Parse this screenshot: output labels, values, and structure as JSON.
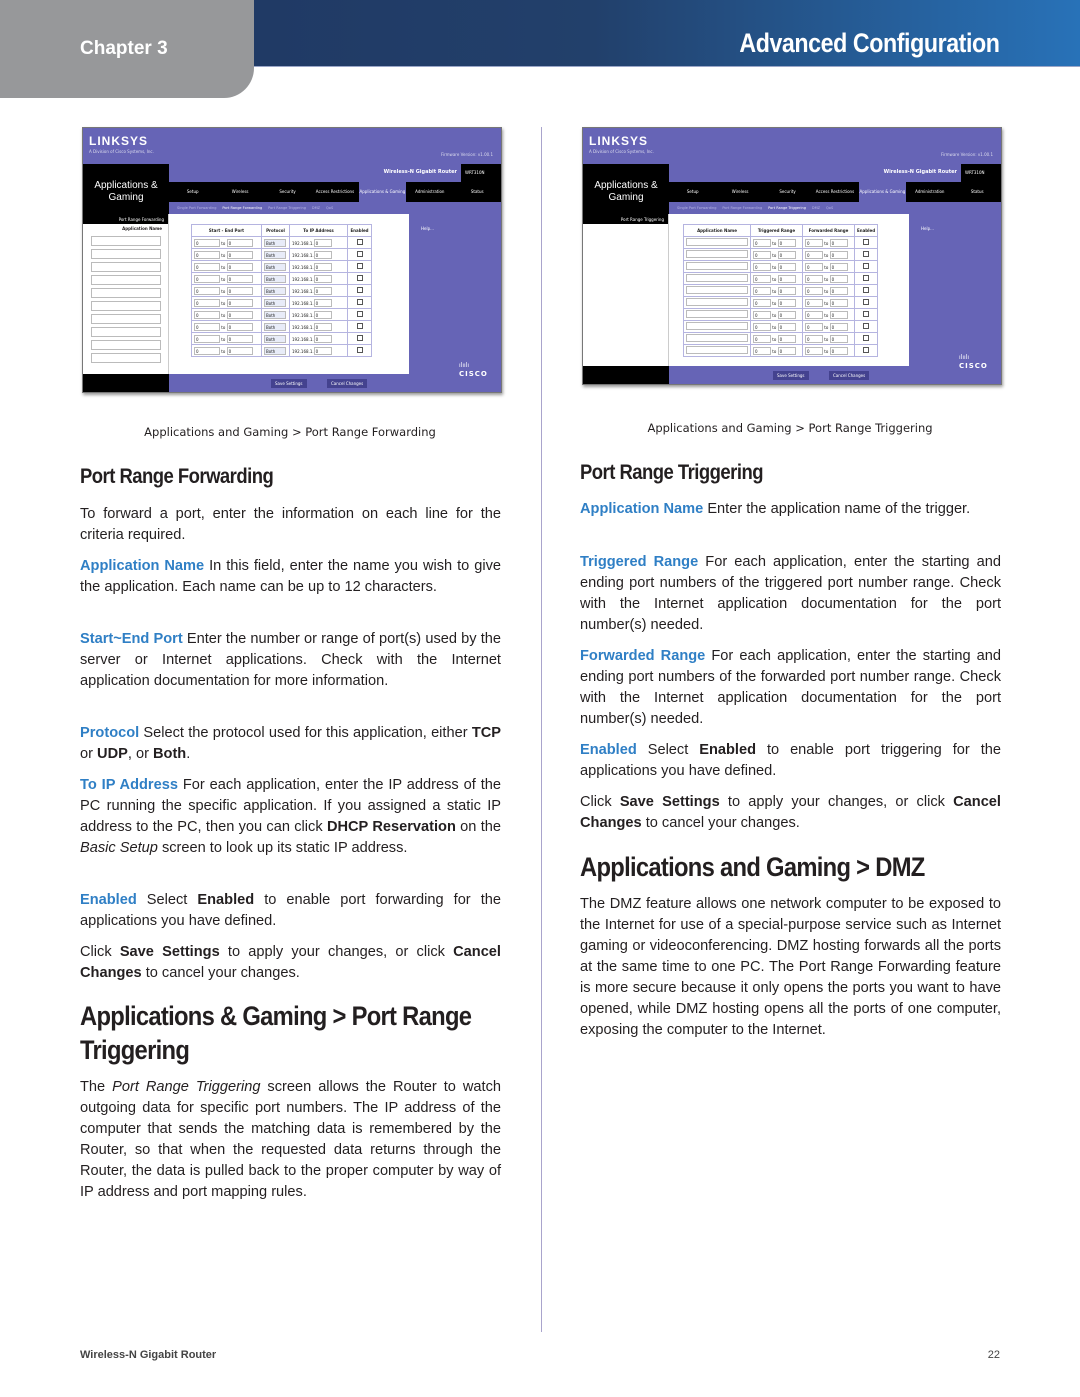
{
  "header": {
    "chapter": "Chapter 3",
    "section": "Advanced Configuration",
    "colors": {
      "bar_dark": "#1f3560",
      "bar_light": "#2872b8",
      "tab_gray": "#97989a",
      "term_blue": "#2f7fc5"
    }
  },
  "screenshots": {
    "common": {
      "logo": "LINKSYS",
      "logo_sub": "A Division of Cisco Systems, Inc.",
      "firmware": "Firmware Version: v1.00.1",
      "product": "Wireless-N Gigabit Router",
      "model": "WRT310N",
      "page_title": "Applications & Gaming",
      "tabs": [
        "Setup",
        "Wireless",
        "Security",
        "Access Restrictions",
        "Applications & Gaming",
        "Administration",
        "Status"
      ],
      "subtabs": [
        "Single Port Forwarding",
        "Port Range Forwarding",
        "Port Range Triggering",
        "DMZ",
        "QoS"
      ],
      "help": "Help...",
      "save": "Save Settings",
      "cancel": "Cancel Changes",
      "brand": "CISCO",
      "brand_bars": "ılıılı"
    },
    "forwarding": {
      "left_header": "Port Range Forwarding",
      "app_name_header": "Application Name",
      "columns": [
        "Start - End Port",
        "Protocol",
        "To IP Address",
        "Enabled"
      ],
      "row": {
        "start": "0",
        "to": "to",
        "end": "0",
        "protocol": "Both",
        "ip_prefix": "192.168.1.",
        "ip_last": "0"
      },
      "row_count": 10,
      "caption": "Applications and Gaming > Port Range Forwarding"
    },
    "triggering": {
      "left_header": "Port Range Triggering",
      "columns": [
        "Application Name",
        "Triggered Range",
        "Forwarded Range",
        "Enabled"
      ],
      "row": {
        "start": "0",
        "to": "to",
        "end": "0"
      },
      "row_count": 10,
      "caption": "Applications and Gaming > Port Range Triggering"
    }
  },
  "left": {
    "h_prf": "Port Range Forwarding",
    "intro": "To forward a port, enter the information on each line for the criteria required.",
    "app_name_term": "Application Name",
    "app_name_text": " In this field, enter the name you wish to give the application. Each name can be up to 12 characters.",
    "port_term": "Start~End Port",
    "port_text": " Enter the number or range of port(s) used by the server or Internet applications. Check with the Internet application documentation for more information.",
    "proto_term": "Protocol",
    "proto_text1": " Select the protocol used for this application, either ",
    "proto_tcp": "TCP",
    "proto_or1": " or ",
    "proto_udp": "UDP",
    "proto_or2": ", or ",
    "proto_both": "Both",
    "proto_end": ".",
    "ip_term": "To IP Address",
    "ip_text1": "  For each application, enter the IP address of the PC running the specific application. If you assigned a static IP address to the PC, then you can click ",
    "ip_dhcp": "DHCP Reservation",
    "ip_text2": " on the ",
    "ip_basic": "Basic Setup",
    "ip_text3": " screen to look up its static IP address.",
    "en_term": "Enabled",
    "en_text1": "  Select ",
    "en_bold": "Enabled",
    "en_text2": " to enable port forwarding for the applications you have defined.",
    "click1": "Click ",
    "save_bold": "Save Settings",
    "click2": " to apply your changes, or click ",
    "cancel_bold": "Cancel Changes",
    "click3": " to cancel your changes.",
    "h_trig_line1": "Applications & Gaming > Port Range",
    "h_trig_line2": "Triggering",
    "trig_the": "The ",
    "trig_italic": "Port Range Triggering",
    "trig_text": " screen allows the Router to watch outgoing data for specific port numbers. The IP address of the computer that sends the matching data is remembered by the Router, so that when the requested data returns through the Router, the data is pulled back to the proper computer by way of IP address and port mapping rules."
  },
  "right": {
    "h_prt": "Port Range Triggering",
    "app_term": "Application Name",
    "app_text": "  Enter the application name of the trigger.",
    "trg_term": "Triggered Range",
    "trg_text": "  For each application, enter the starting and ending port numbers of the triggered port number range. Check with the Internet application documentation for the port number(s) needed.",
    "fwd_term": "Forwarded Range",
    "fwd_text": "  For each application, enter the starting and ending port numbers of the forwarded port number range. Check with the Internet application documentation for the port number(s) needed.",
    "en_term": "Enabled",
    "en_text1": "  Select ",
    "en_bold": "Enabled",
    "en_text2": " to enable port triggering for the applications you have defined.",
    "click1": "Click ",
    "save_bold": "Save Settings",
    "click2": " to apply your changes, or click ",
    "cancel_bold": "Cancel Changes",
    "click3": " to cancel your changes.",
    "h_dmz": "Applications and Gaming > DMZ",
    "dmz_text": "The DMZ feature allows one network computer to be exposed to the Internet for use of a special-purpose service such as Internet gaming or videoconferencing. DMZ hosting forwards all the ports at the same time to one PC. The Port Range Forwarding feature is more secure because it only opens the ports you want to have opened, while DMZ hosting opens all the ports of one computer, exposing the computer to the Internet."
  },
  "footer": {
    "product": "Wireless-N Gigabit Router",
    "page": "22"
  }
}
